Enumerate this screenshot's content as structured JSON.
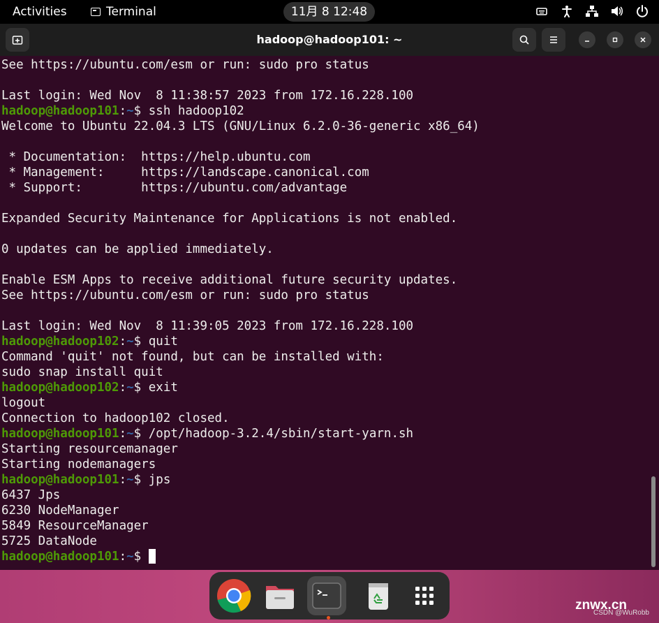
{
  "topbar": {
    "activities": "Activities",
    "app_name": "Terminal",
    "clock": "11月 8  12:48",
    "tray_icons": [
      "keyboard-icon",
      "accessibility-icon",
      "network-icon",
      "volume-icon",
      "power-icon"
    ]
  },
  "window": {
    "title": "hadoop@hadoop101: ~"
  },
  "terminal": {
    "lines": [
      {
        "type": "text",
        "text": "See https://ubuntu.com/esm or run: sudo pro status"
      },
      {
        "type": "text",
        "text": ""
      },
      {
        "type": "text",
        "text": "Last login: Wed Nov  8 11:38:57 2023 from 172.16.228.100"
      },
      {
        "type": "prompt",
        "user": "hadoop@hadoop101",
        "path": "~",
        "cmd": " ssh hadoop102"
      },
      {
        "type": "text",
        "text": "Welcome to Ubuntu 22.04.3 LTS (GNU/Linux 6.2.0-36-generic x86_64)"
      },
      {
        "type": "text",
        "text": ""
      },
      {
        "type": "text",
        "text": " * Documentation:  https://help.ubuntu.com"
      },
      {
        "type": "text",
        "text": " * Management:     https://landscape.canonical.com"
      },
      {
        "type": "text",
        "text": " * Support:        https://ubuntu.com/advantage"
      },
      {
        "type": "text",
        "text": ""
      },
      {
        "type": "text",
        "text": "Expanded Security Maintenance for Applications is not enabled."
      },
      {
        "type": "text",
        "text": ""
      },
      {
        "type": "text",
        "text": "0 updates can be applied immediately."
      },
      {
        "type": "text",
        "text": ""
      },
      {
        "type": "text",
        "text": "Enable ESM Apps to receive additional future security updates."
      },
      {
        "type": "text",
        "text": "See https://ubuntu.com/esm or run: sudo pro status"
      },
      {
        "type": "text",
        "text": ""
      },
      {
        "type": "text",
        "text": "Last login: Wed Nov  8 11:39:05 2023 from 172.16.228.100"
      },
      {
        "type": "prompt",
        "user": "hadoop@hadoop102",
        "path": "~",
        "cmd": " quit"
      },
      {
        "type": "text",
        "text": "Command 'quit' not found, but can be installed with:"
      },
      {
        "type": "text",
        "text": "sudo snap install quit"
      },
      {
        "type": "prompt",
        "user": "hadoop@hadoop102",
        "path": "~",
        "cmd": " exit"
      },
      {
        "type": "text",
        "text": "logout"
      },
      {
        "type": "text",
        "text": "Connection to hadoop102 closed."
      },
      {
        "type": "prompt",
        "user": "hadoop@hadoop101",
        "path": "~",
        "cmd": " /opt/hadoop-3.2.4/sbin/start-yarn.sh"
      },
      {
        "type": "text",
        "text": "Starting resourcemanager"
      },
      {
        "type": "text",
        "text": "Starting nodemanagers"
      },
      {
        "type": "prompt",
        "user": "hadoop@hadoop101",
        "path": "~",
        "cmd": " jps"
      },
      {
        "type": "text",
        "text": "6437 Jps"
      },
      {
        "type": "text",
        "text": "6230 NodeManager"
      },
      {
        "type": "text",
        "text": "5849 ResourceManager"
      },
      {
        "type": "text",
        "text": "5725 DataNode"
      },
      {
        "type": "prompt",
        "user": "hadoop@hadoop101",
        "path": "~",
        "cmd": " ",
        "cursor": true
      }
    ]
  },
  "dock": {
    "apps": [
      "chrome-icon",
      "files-icon",
      "terminal-icon",
      "trash-icon",
      "show-apps-icon"
    ],
    "active": "terminal-icon"
  },
  "watermark": {
    "main": "znwx.cn",
    "sub": "CSDN @WuRobb"
  },
  "colors": {
    "terminal_bg": "#300a24",
    "prompt_user": "#4e9a06",
    "prompt_path": "#3465a4",
    "accent": "#e95420"
  }
}
